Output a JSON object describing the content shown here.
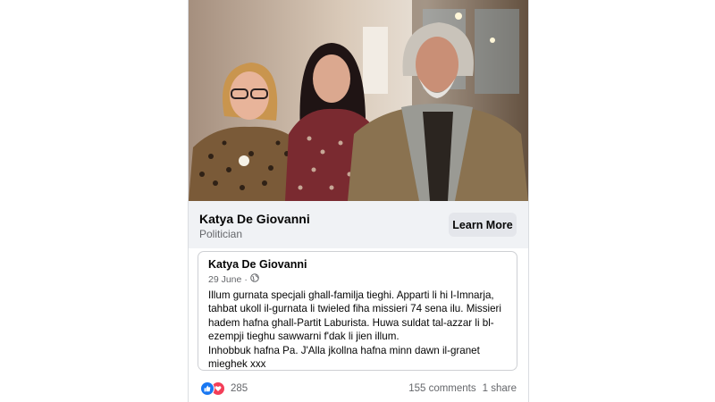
{
  "link_preview": {
    "title": "Katya De Giovanni",
    "subtitle": "Politician",
    "button_label": "Learn More"
  },
  "quoted_post": {
    "author": "Katya De Giovanni",
    "date": "29 June",
    "separator": "·",
    "privacy_icon": "globe-icon",
    "text": "Illum gurnata specjali ghall-familja tieghi. Apparti li hi l-Imnarja,\ntahbat ukoll il-gurnata li twieled fiha missieri 74 sena ilu. Missieri\nhadem hafna ghall-Partit Laburista. Huwa suldat tal-azzar li bl-\nezempji tieghu sawwarni f'dak li jien illum.\nInhobbuk hafna Pa. J'Alla jkollna hafna minn dawn il-granet\nmieghek xxx"
  },
  "engagement": {
    "reaction_icons": [
      "like-icon",
      "love-icon"
    ],
    "reaction_count": "285",
    "comments": "155 comments",
    "shares": "1 share"
  },
  "colors": {
    "brand_blue": "#1877f2",
    "love_red": "#f33e58",
    "secondary_text": "#65676b"
  }
}
